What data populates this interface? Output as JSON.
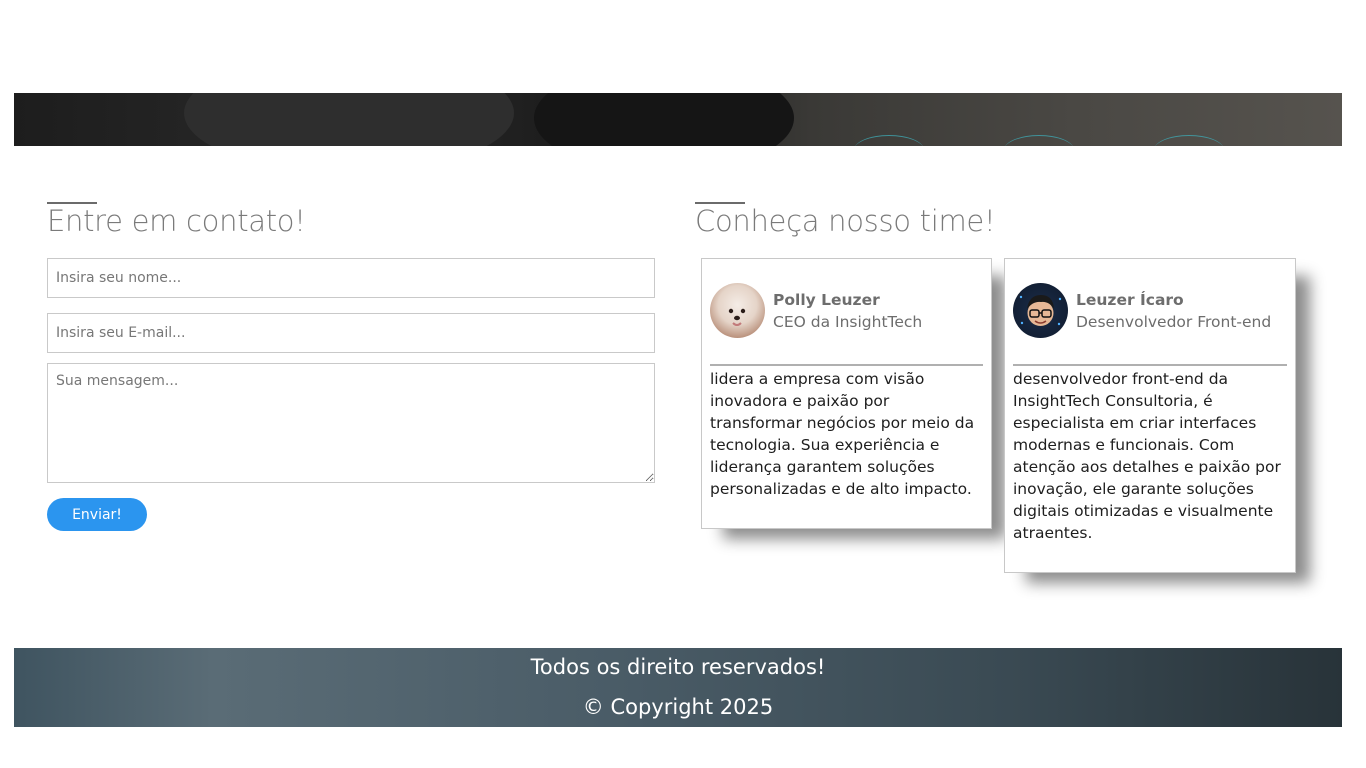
{
  "contact": {
    "title": "Entre em contato!",
    "name_placeholder": "Insira seu nome...",
    "email_placeholder": "Insira seu E-mail...",
    "message_placeholder": "Sua mensagem...",
    "submit_label": "Enviar!"
  },
  "team": {
    "title": "Conheça nosso time!",
    "members": [
      {
        "name": "Polly Leuzer",
        "role": "CEO da InsightTech",
        "bio": "lidera a empresa com visão inovadora e paixão por transformar negócios por meio da tecnologia. Sua experiência e liderança garantem soluções personalizadas e de alto impacto."
      },
      {
        "name": "Leuzer Ícaro",
        "role": "Desenvolvedor Front-end",
        "bio": "desenvolvedor front-end da InsightTech Consultoria, é especialista em criar interfaces modernas e funcionais. Com atenção aos detalhes e paixão por inovação, ele garante soluções digitais otimizadas e visualmente atraentes."
      }
    ]
  },
  "footer": {
    "rights": "Todos os direito reservados!",
    "copyright": "© Copyright 2025"
  },
  "colors": {
    "accent": "#2b95ef",
    "footer_dark": "#283339"
  }
}
